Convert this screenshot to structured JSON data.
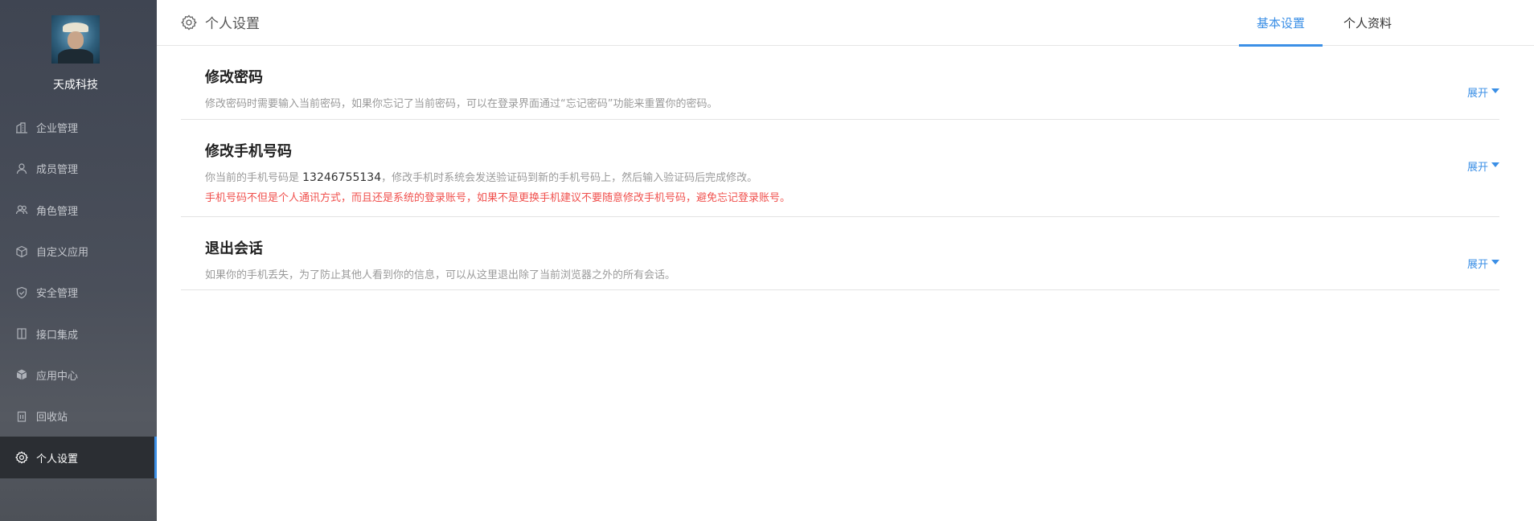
{
  "sidebar": {
    "company_name": "天成科技",
    "items": [
      {
        "label": "企业管理",
        "icon": "building-icon"
      },
      {
        "label": "成员管理",
        "icon": "user-icon"
      },
      {
        "label": "角色管理",
        "icon": "users-icon"
      },
      {
        "label": "自定义应用",
        "icon": "cube-icon"
      },
      {
        "label": "安全管理",
        "icon": "shield-check-icon"
      },
      {
        "label": "接口集成",
        "icon": "columns-icon"
      },
      {
        "label": "应用中心",
        "icon": "box-icon"
      },
      {
        "label": "回收站",
        "icon": "trash-icon"
      },
      {
        "label": "个人设置",
        "icon": "gear-icon",
        "active": true
      }
    ]
  },
  "header": {
    "title": "个人设置",
    "tabs": [
      {
        "label": "基本设置",
        "active": true
      },
      {
        "label": "个人资料",
        "active": false
      }
    ]
  },
  "sections": {
    "password": {
      "title": "修改密码",
      "description": "修改密码时需要输入当前密码，如果你忘记了当前密码，可以在登录界面通过“忘记密码”功能来重置你的密码。",
      "expand_label": "展开"
    },
    "phone": {
      "title": "修改手机号码",
      "description_prefix": "你当前的手机号码是 ",
      "phone_number": "13246755134",
      "description_suffix": "，修改手机时系统会发送验证码到新的手机号码上，然后输入验证码后完成修改。",
      "warning": "手机号码不但是个人通讯方式，而且还是系统的登录账号，如果不是更换手机建议不要随意修改手机号码，避免忘记登录账号。",
      "expand_label": "展开"
    },
    "logout": {
      "title": "退出会话",
      "description": "如果你的手机丢失，为了防止其他人看到你的信息，可以从这里退出除了当前浏览器之外的所有会话。",
      "expand_label": "展开"
    }
  },
  "colors": {
    "accent": "#3b8fe6",
    "warning": "#f0504d",
    "sidebar_bg": "#474c56",
    "sidebar_active_bg": "#2b2e33"
  }
}
